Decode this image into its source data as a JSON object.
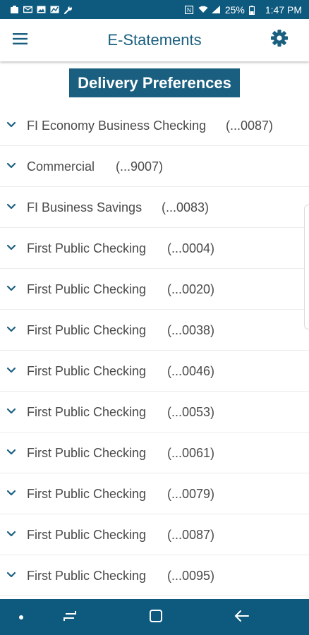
{
  "status_bar": {
    "battery": "25%",
    "time": "1:47 PM"
  },
  "header": {
    "title": "E-Statements"
  },
  "banner": {
    "label": "Delivery Preferences"
  },
  "accounts": [
    {
      "name": "FI Economy Business Checking",
      "number": "(...0087)"
    },
    {
      "name": "Commercial",
      "number": "(...9007)"
    },
    {
      "name": "FI Business Savings",
      "number": "(...0083)"
    },
    {
      "name": "First Public Checking",
      "number": "(...0004)"
    },
    {
      "name": "First Public Checking",
      "number": "(...0020)"
    },
    {
      "name": "First Public Checking",
      "number": "(...0038)"
    },
    {
      "name": "First Public Checking",
      "number": "(...0046)"
    },
    {
      "name": "First Public Checking",
      "number": "(...0053)"
    },
    {
      "name": "First Public Checking",
      "number": "(...0061)"
    },
    {
      "name": "First Public Checking",
      "number": "(...0079)"
    },
    {
      "name": "First Public Checking",
      "number": "(...0087)"
    },
    {
      "name": "First Public Checking",
      "number": "(...0095)"
    }
  ],
  "icons": {
    "menu": "hamburger-icon",
    "settings": "gear-icon",
    "expand": "chevron-down-icon",
    "nav_recent": "recent-apps-icon",
    "nav_home": "home-icon",
    "nav_back": "back-icon"
  },
  "colors": {
    "primary": "#1a5f80",
    "status_bar": "#0e5a7f",
    "text": "#4a4a4a"
  }
}
